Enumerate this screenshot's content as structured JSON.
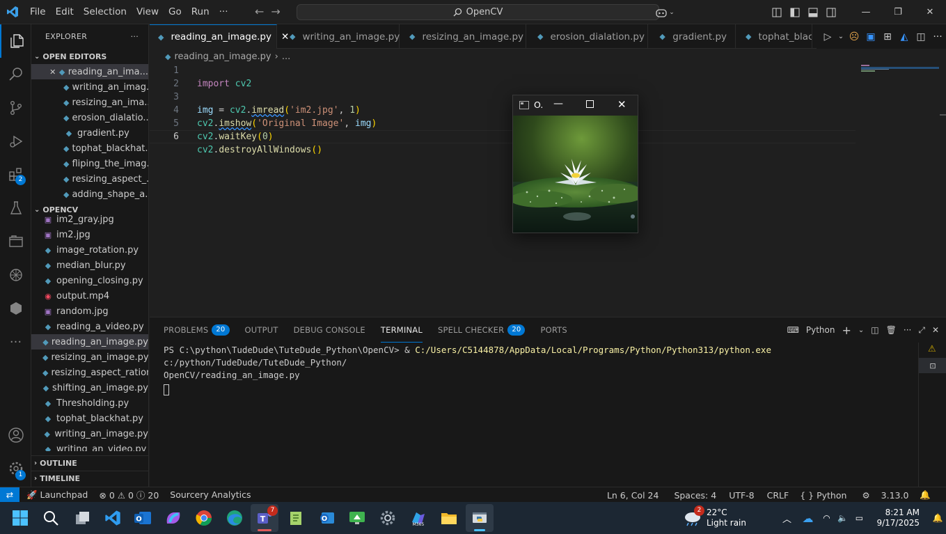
{
  "titlebar": {
    "menu": [
      "File",
      "Edit",
      "Selection",
      "View",
      "Go",
      "Run",
      "···"
    ],
    "search_text": "OpenCV"
  },
  "activity": {
    "extensions_badge": "2",
    "settings_badge": "1"
  },
  "explorer": {
    "title": "EXPLORER",
    "more": "···",
    "open_editors_header": "OPEN EDITORS",
    "open_editors": [
      "reading_an_ima...",
      "writing_an_imag...",
      "resizing_an_ima...",
      "erosion_dialatio...",
      "gradient.py",
      "tophat_blackhat...",
      "fliping_the_imag...",
      "resizing_aspect_...",
      "adding_shape_a..."
    ],
    "folder_header": "OPENCV",
    "files": [
      {
        "name": "im2_gray.jpg",
        "type": "jpg"
      },
      {
        "name": "im2.jpg",
        "type": "jpg"
      },
      {
        "name": "image_rotation.py",
        "type": "py"
      },
      {
        "name": "median_blur.py",
        "type": "py"
      },
      {
        "name": "opening_closing.py",
        "type": "py"
      },
      {
        "name": "output.mp4",
        "type": "mp4"
      },
      {
        "name": "random.jpg",
        "type": "jpg"
      },
      {
        "name": "reading_a_video.py",
        "type": "py"
      },
      {
        "name": "reading_an_image.py",
        "type": "py"
      },
      {
        "name": "resizing_an_image.py",
        "type": "py"
      },
      {
        "name": "resizing_aspect_ration...",
        "type": "py"
      },
      {
        "name": "shifting_an_image.py",
        "type": "py"
      },
      {
        "name": "Thresholding.py",
        "type": "py"
      },
      {
        "name": "tophat_blackhat.py",
        "type": "py"
      },
      {
        "name": "writing_an_image.py",
        "type": "py"
      },
      {
        "name": "writing_an_video.py",
        "type": "py"
      }
    ],
    "outline_header": "OUTLINE",
    "timeline_header": "TIMELINE"
  },
  "tabs": [
    "reading_an_image.py",
    "writing_an_image.py",
    "resizing_an_image.py",
    "erosion_dialation.py",
    "gradient.py",
    "tophat_blac"
  ],
  "breadcrumb": {
    "file": "reading_an_image.py",
    "rest": "..."
  },
  "code": {
    "line_numbers": [
      "1",
      "2",
      "3",
      "4",
      "5",
      "6"
    ],
    "l1_kw": "import",
    "l1_mod": "cv2",
    "l3_var": "img",
    "l3_eq": " = ",
    "l3_mod": "cv2",
    "l3_fn": "imread",
    "l3_str": "'im2.jpg'",
    "l3_num": "1",
    "l4_mod": "cv2",
    "l4_fn": "imshow",
    "l4_str": "'Original Image'",
    "l4_var": "img",
    "l5_mod": "cv2",
    "l5_fn": "waitKey",
    "l5_num": "0",
    "l6_mod": "cv2",
    "l6_fn": "destroyAllWindows"
  },
  "image_window": {
    "title": "O."
  },
  "panel": {
    "tabs": [
      "PROBLEMS",
      "OUTPUT",
      "DEBUG CONSOLE",
      "TERMINAL",
      "SPELL CHECKER",
      "PORTS"
    ],
    "problems_badge": "20",
    "spell_badge": "20",
    "shell": "Python",
    "terminal_prompt": "PS C:\\python\\TudeDude\\TuteDude_Python\\OpenCV> & ",
    "terminal_exe": "C:/Users/C5144878/AppData/Local/Programs/Python/Python313/python.exe",
    "terminal_arg": " c:/python/TudeDude/TuteDude_Python/",
    "terminal_line2": "OpenCV/reading_an_image.py"
  },
  "status": {
    "launchpad": "Launchpad",
    "errors": "0",
    "warnings": "0",
    "infos": "20",
    "sourcery": "Sourcery Analytics",
    "position": "Ln 6, Col 24",
    "spaces": "Spaces: 4",
    "encoding": "UTF-8",
    "eol": "CRLF",
    "language": "Python",
    "version": "3.13.0"
  },
  "taskbar": {
    "teams_badge": "7",
    "weather_badge": "2",
    "temp": "22°C",
    "weather": "Light rain",
    "time": "8:21 AM",
    "date": "9/17/2025"
  }
}
